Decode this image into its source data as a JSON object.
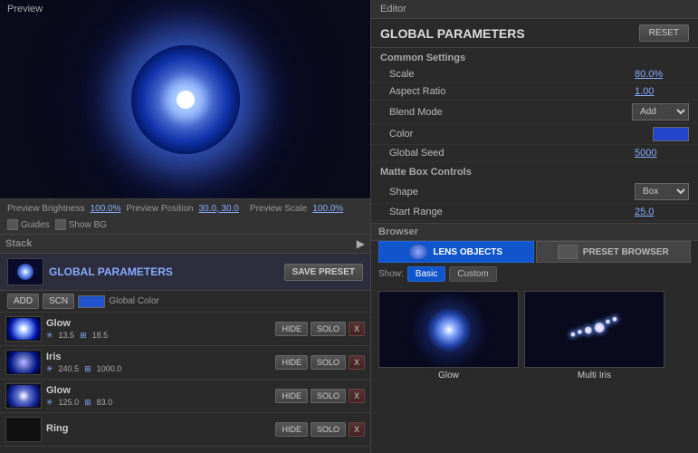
{
  "left_panel": {
    "preview_label": "Preview",
    "preview_brightness_label": "Preview Brightness",
    "preview_brightness_value": "100.0%",
    "preview_scale_label": "Preview Scale",
    "preview_scale_value": "100.0%",
    "preview_position_label": "Preview Position",
    "preview_position_value": "30.0, 30.0",
    "guides_label": "Guides",
    "show_bg_label": "Show BG",
    "stack_label": "Stack",
    "global_params_title": "GLOBAL PARAMETERS",
    "save_preset_label": "SAVE PRESET",
    "add_label": "ADD",
    "scn_label": "SCN",
    "global_color_label": "Global Color",
    "layers": [
      {
        "name": "Glow",
        "param1_icon": "✳",
        "param1_value": "13.5",
        "param2_icon": "⊞",
        "param2_value": "18.5",
        "hide_label": "HIDE",
        "solo_label": "SOLO",
        "x_label": "X"
      },
      {
        "name": "Iris",
        "param1_icon": "✳",
        "param1_value": "240.5",
        "param2_icon": "⊞",
        "param2_value": "1000.0",
        "hide_label": "HIDE",
        "solo_label": "SOLO",
        "x_label": "X"
      },
      {
        "name": "Glow",
        "param1_icon": "✳",
        "param1_value": "125.0",
        "param2_icon": "⊞",
        "param2_value": "83.0",
        "hide_label": "HIDE",
        "solo_label": "SOLO",
        "x_label": "X"
      },
      {
        "name": "Ring",
        "param1_icon": "✳",
        "param1_value": "",
        "param2_icon": "⊞",
        "param2_value": "",
        "hide_label": "HIDE",
        "solo_label": "SOLO",
        "x_label": "X"
      }
    ]
  },
  "right_panel": {
    "editor_label": "Editor",
    "global_params_title": "GLOBAL PARAMETERS",
    "reset_label": "RESET",
    "common_settings_title": "Common Settings",
    "scale_label": "Scale",
    "scale_value": "80.0%",
    "aspect_ratio_label": "Aspect Ratio",
    "aspect_ratio_value": "1.00",
    "blend_mode_label": "Blend Mode",
    "blend_mode_value": "Add",
    "color_label": "Color",
    "global_seed_label": "Global Seed",
    "global_seed_value": "5000",
    "matte_box_title": "Matte Box Controls",
    "shape_label": "Shape",
    "shape_value": "Box",
    "start_range_label": "Start Range",
    "start_range_value": "25.0",
    "browser_label": "Browser",
    "lens_objects_label": "LENS OBJECTS",
    "preset_browser_label": "PRESET BROWSER",
    "show_label": "Show:",
    "basic_label": "Basic",
    "custom_label": "Custom",
    "browser_items": [
      {
        "label": "Glow"
      },
      {
        "label": "Multi Iris"
      }
    ]
  }
}
